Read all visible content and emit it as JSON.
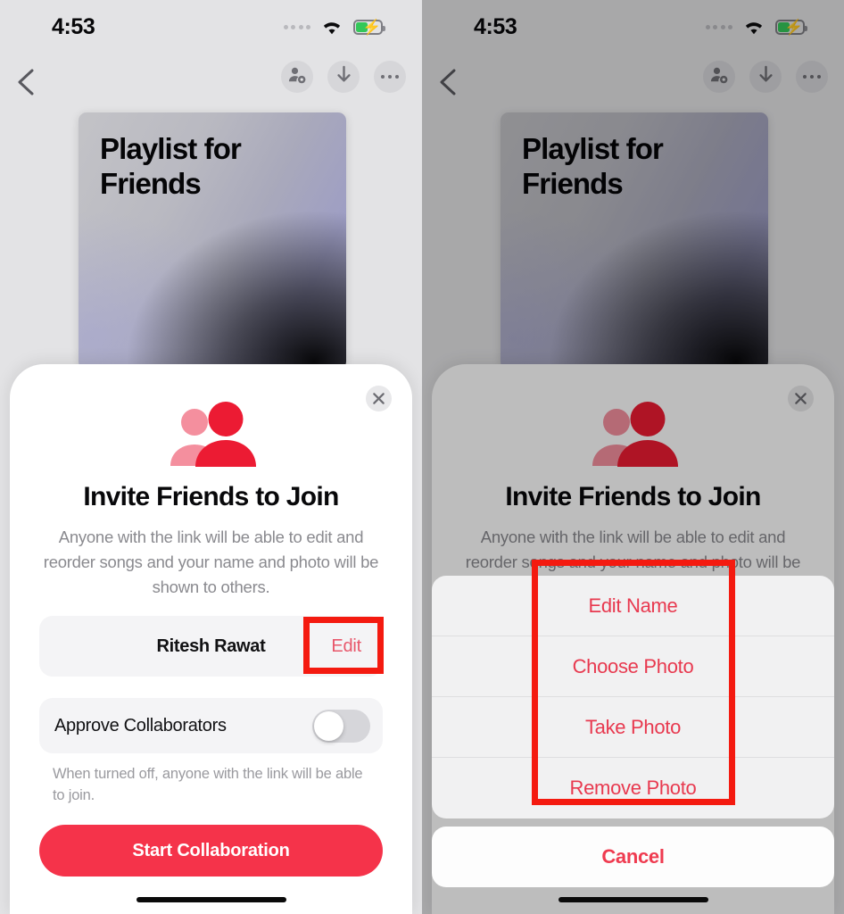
{
  "status_bar": {
    "time": "4:53",
    "signal_icon": "signal-dots-icon",
    "wifi_icon": "wifi-icon",
    "battery_icon": "battery-charging-icon",
    "battery_charging": true
  },
  "nav": {
    "back_icon": "chevron-left-icon",
    "collaborate_icon": "person-badge-gear-icon",
    "download_icon": "download-arrow-icon",
    "more_icon": "ellipsis-icon"
  },
  "artwork": {
    "title": "Playlist for\nFriends",
    "title_line1": "Playlist for",
    "title_line2": "Friends"
  },
  "sheet": {
    "close_icon": "close-x-icon",
    "people_icon": "two-people-icon",
    "title": "Invite Friends to Join",
    "description": "Anyone with the link will be able to edit and reorder songs and your name and photo will be shown to others.",
    "name_row": {
      "name": "Ritesh Rawat",
      "edit_label": "Edit"
    },
    "toggle_row": {
      "label": "Approve Collaborators",
      "value": "off"
    },
    "toggle_note": "When turned off, anyone with the link will be able to join.",
    "cta_label": "Start Collaboration"
  },
  "action_sheet": {
    "items": [
      {
        "label": "Edit Name"
      },
      {
        "label": "Choose Photo"
      },
      {
        "label": "Take Photo"
      },
      {
        "label": "Remove Photo"
      }
    ],
    "cancel_label": "Cancel"
  },
  "colors": {
    "accent_red": "#f5334a",
    "annotation_red": "#f41a10",
    "menu_red": "#e8394f",
    "battery_green": "#34c759",
    "people_icon_front": "#ec1b33",
    "people_icon_back": "#f48f9e"
  }
}
